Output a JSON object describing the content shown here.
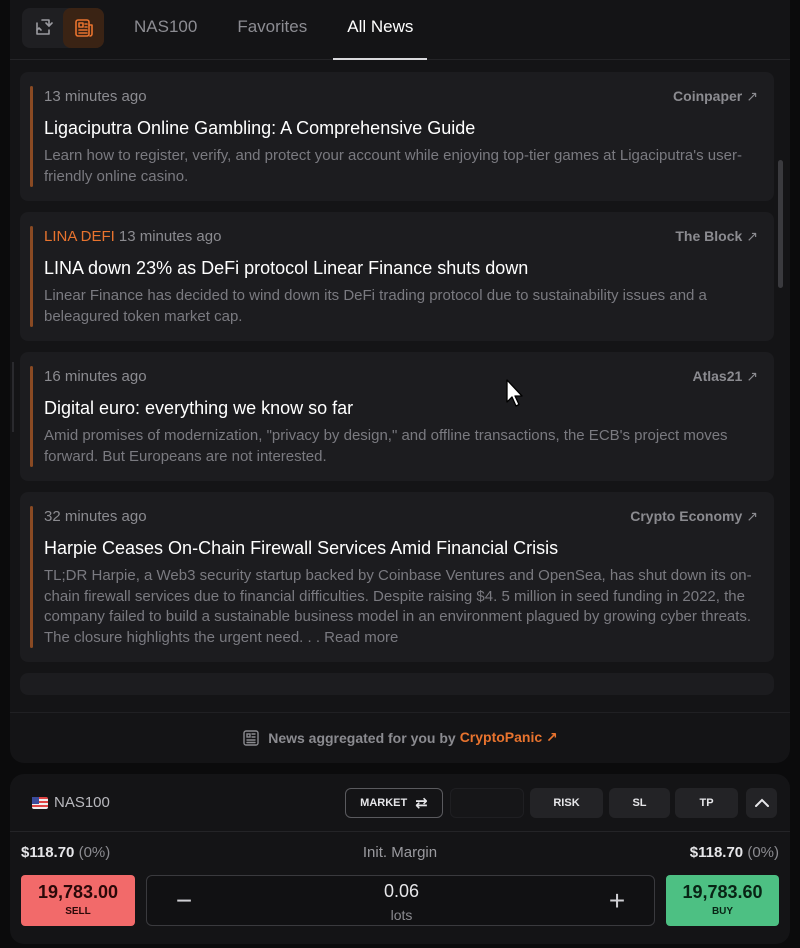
{
  "header": {
    "tabs": [
      {
        "label": "NAS100",
        "active": false
      },
      {
        "label": "Favorites",
        "active": false
      },
      {
        "label": "All News",
        "active": true
      }
    ],
    "icons": [
      "swap-icon",
      "newspaper-icon"
    ]
  },
  "news": [
    {
      "tag": "",
      "time": "13 minutes ago",
      "source": "Coinpaper",
      "title": "Ligaciputra Online Gambling: A Comprehensive Guide",
      "description": "Learn how to register, verify, and protect your account while enjoying top-tier games at Ligaciputra's user-friendly online casino."
    },
    {
      "tag": "LINA DEFI",
      "time": "13 minutes ago",
      "source": "The Block",
      "title": "LINA down 23% as DeFi protocol Linear Finance shuts down",
      "description": "Linear Finance has decided to wind down its DeFi trading protocol due to sustainability issues and a beleagured token market cap."
    },
    {
      "tag": "",
      "time": "16 minutes ago",
      "source": "Atlas21",
      "title": "Digital euro: everything we know so far",
      "description": "Amid promises of modernization, \"privacy by design,\" and offline transactions, the ECB's project moves forward. But Europeans are not interested."
    },
    {
      "tag": "",
      "time": "32 minutes ago",
      "source": "Crypto Economy",
      "title": "Harpie Ceases On-Chain Firewall Services Amid Financial Crisis",
      "description": "TL;DR Harpie, a Web3 security startup backed by Coinbase Ventures and OpenSea, has shut down its on-chain firewall services due to financial difficulties. Despite raising $4. 5 million in seed funding in 2022, the company failed to build a sustainable business model in an environment plagued by growing cyber threats. The closure highlights the urgent need. . . Read more"
    }
  ],
  "footer": {
    "text": "News aggregated for you by",
    "brand": "CryptoPanic",
    "brand_arrow": "↗"
  },
  "trade": {
    "symbol": "NAS100",
    "market_label": "MARKET",
    "risk_label": "RISK",
    "sl_label": "SL",
    "tp_label": "TP",
    "margin_left_value": "$118.70",
    "margin_left_pct": "(0%)",
    "margin_label": "Init. Margin",
    "margin_right_value": "$118.70",
    "margin_right_pct": "(0%)",
    "sell_price": "19,783.00",
    "sell_label": "SELL",
    "buy_price": "19,783.60",
    "buy_label": "BUY",
    "lots_value": "0.06",
    "lots_unit": "lots"
  },
  "colors": {
    "accent": "#e8732e",
    "sell": "#f26a6a",
    "buy": "#4dc083"
  }
}
